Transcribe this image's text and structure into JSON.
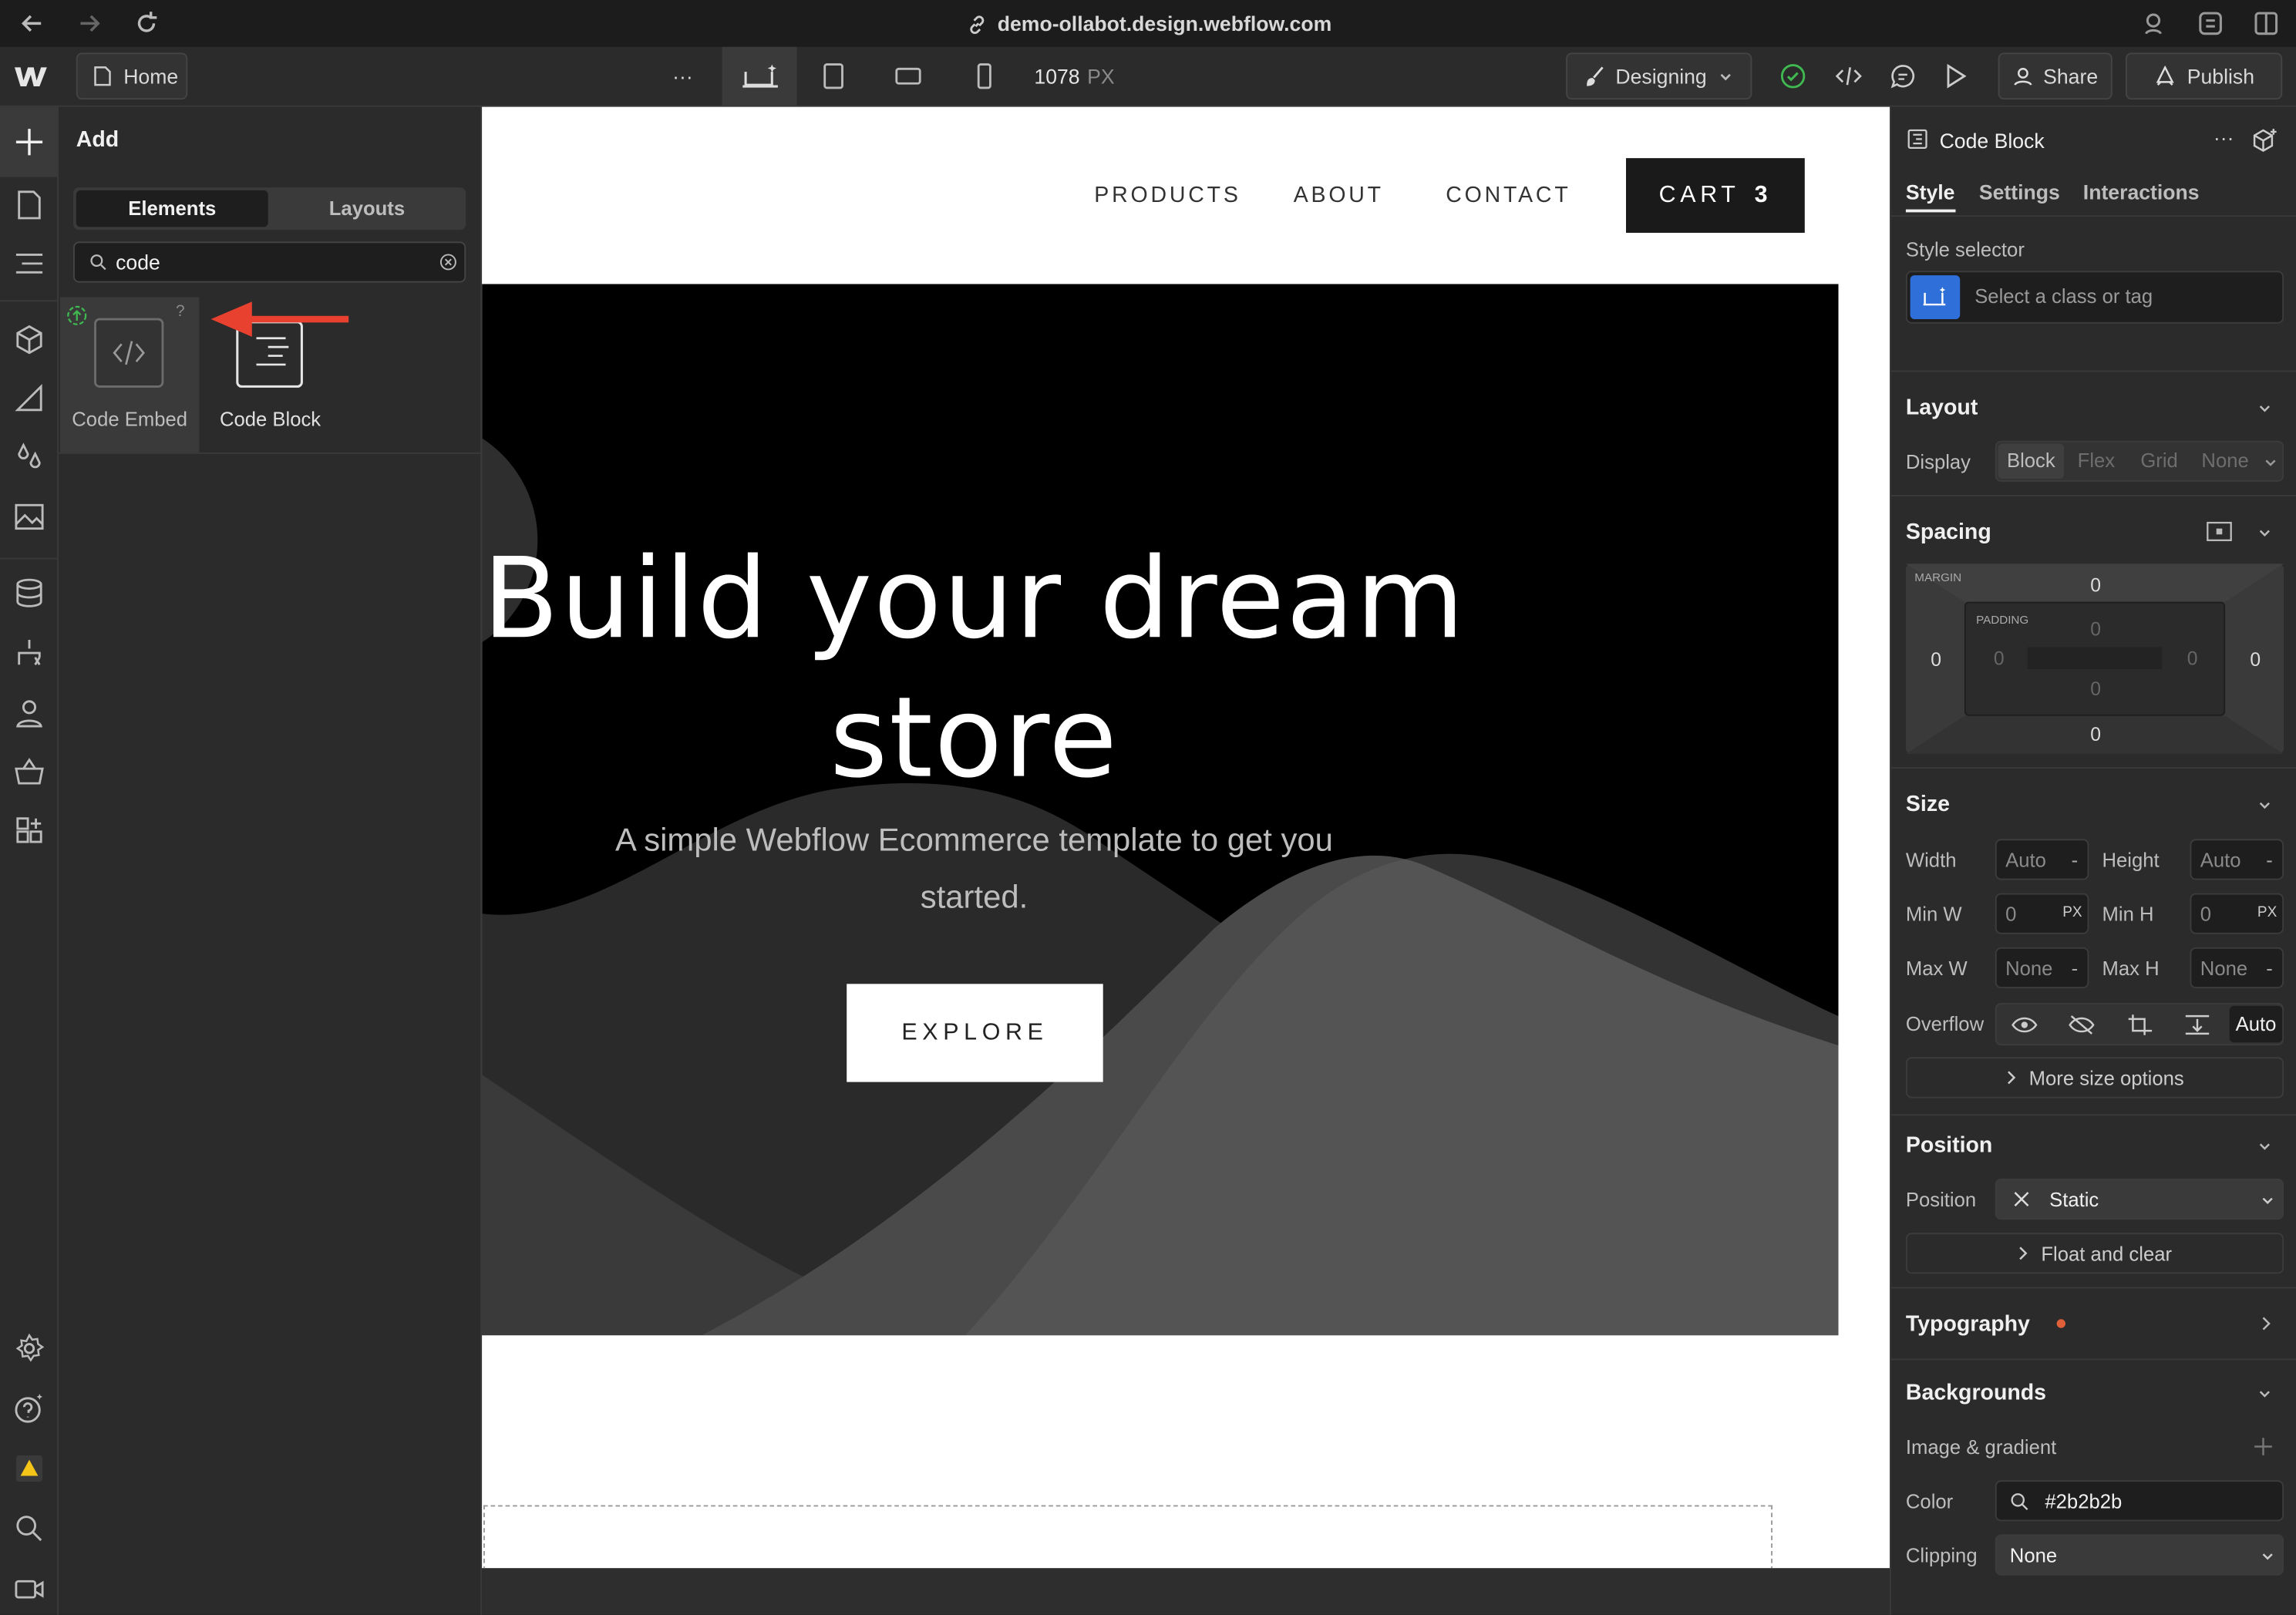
{
  "browser": {
    "url": "demo-ollabot.design.webflow.com"
  },
  "toolbar": {
    "page_name": "Home",
    "more": "···",
    "width_value": "1078",
    "width_unit": "PX",
    "mode": "Designing",
    "share": "Share",
    "publish": "Publish"
  },
  "add_panel": {
    "title": "Add",
    "tabs": [
      "Elements",
      "Layouts"
    ],
    "search_value": "code",
    "results": [
      {
        "label": "Code Embed",
        "badge": "?"
      },
      {
        "label": "Code Block"
      }
    ]
  },
  "site": {
    "nav": [
      "PRODUCTS",
      "ABOUT",
      "CONTACT"
    ],
    "cart_label": "CART",
    "cart_count": "3",
    "hero_title_line1": "Build your dream",
    "hero_title_line2": "store",
    "hero_sub_line1": "A simple Webflow Ecommerce template to get you",
    "hero_sub_line2": "started.",
    "cta": "EXPLORE"
  },
  "style_panel": {
    "element_name": "Code Block",
    "more": "···",
    "tabs": [
      "Style",
      "Settings",
      "Interactions"
    ],
    "style_selector_label": "Style selector",
    "style_selector_placeholder": "Select a class or tag",
    "layout": {
      "title": "Layout",
      "display_label": "Display",
      "options": [
        "Block",
        "Flex",
        "Grid",
        "None"
      ],
      "selected": "Block"
    },
    "spacing": {
      "title": "Spacing",
      "margin_label": "MARGIN",
      "padding_label": "PADDING",
      "margin": {
        "top": "0",
        "right": "0",
        "bottom": "0",
        "left": "0"
      },
      "padding": {
        "top": "0",
        "right": "0",
        "bottom": "0",
        "left": "0"
      }
    },
    "size": {
      "title": "Size",
      "width_label": "Width",
      "width": "Auto",
      "width_unit": "-",
      "height_label": "Height",
      "height": "Auto",
      "height_unit": "-",
      "minw_label": "Min W",
      "minw": "0",
      "minw_unit": "PX",
      "minh_label": "Min H",
      "minh": "0",
      "minh_unit": "PX",
      "maxw_label": "Max W",
      "maxw": "None",
      "maxw_unit": "-",
      "maxh_label": "Max H",
      "maxh": "None",
      "maxh_unit": "-",
      "overflow_label": "Overflow",
      "overflow_selected": "Auto",
      "more_options": "More size options"
    },
    "position": {
      "title": "Position",
      "label": "Position",
      "value": "Static",
      "float_clear": "Float and clear"
    },
    "typography": {
      "title": "Typography",
      "indicator_color": "#e0603a"
    },
    "backgrounds": {
      "title": "Backgrounds",
      "image_gradient": "Image & gradient",
      "color_label": "Color",
      "color_value": "#2b2b2b",
      "clipping_label": "Clipping",
      "clipping_value": "None"
    }
  },
  "colors": {
    "accent_blue": "#2e6fd9",
    "arrow_red": "#e8412f",
    "status_green": "#3fb950"
  },
  "icons": [
    "back-arrow-icon",
    "forward-arrow-icon",
    "reload-icon",
    "link-icon",
    "webflow-logo-icon",
    "page-icon",
    "desktop-icon",
    "tablet-icon",
    "landscape-icon",
    "phone-icon",
    "brush-icon",
    "check-circle-icon",
    "code-icon",
    "comment-icon",
    "play-icon",
    "user-icon",
    "publish-icon",
    "plus-icon",
    "pages-icon",
    "navigator-icon",
    "components-icon",
    "style-manager-icon",
    "variables-icon",
    "assets-icon",
    "cms-icon",
    "logic-icon",
    "users-icon",
    "ecommerce-icon",
    "apps-icon",
    "settings-icon",
    "help-icon",
    "audit-warning-icon",
    "search-icon",
    "video-icon"
  ]
}
